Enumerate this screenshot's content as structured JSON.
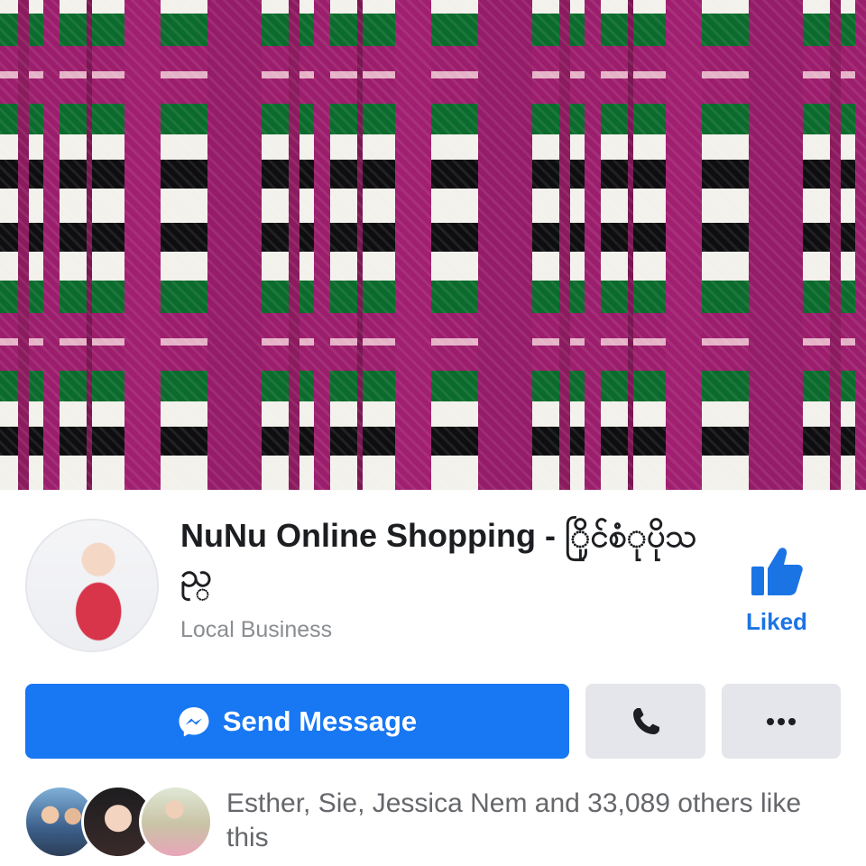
{
  "cover": {
    "alt": ""
  },
  "profile": {
    "name": "NuNu Online Shopping - ြိုင်စံုပိုသည္",
    "category": "Local Business"
  },
  "like_button": {
    "label": "Liked",
    "icon": "thumbs-up-icon",
    "color": "#1b74e4"
  },
  "actions": {
    "send_message_label": "Send Message",
    "send_message_icon": "messenger-icon",
    "call_icon": "phone-icon",
    "more_icon": "more-dots-icon",
    "primary_color": "#1877f2"
  },
  "social": {
    "likes_text": "Esther, Sie, Jessica Nem and 33,089 others like this"
  }
}
